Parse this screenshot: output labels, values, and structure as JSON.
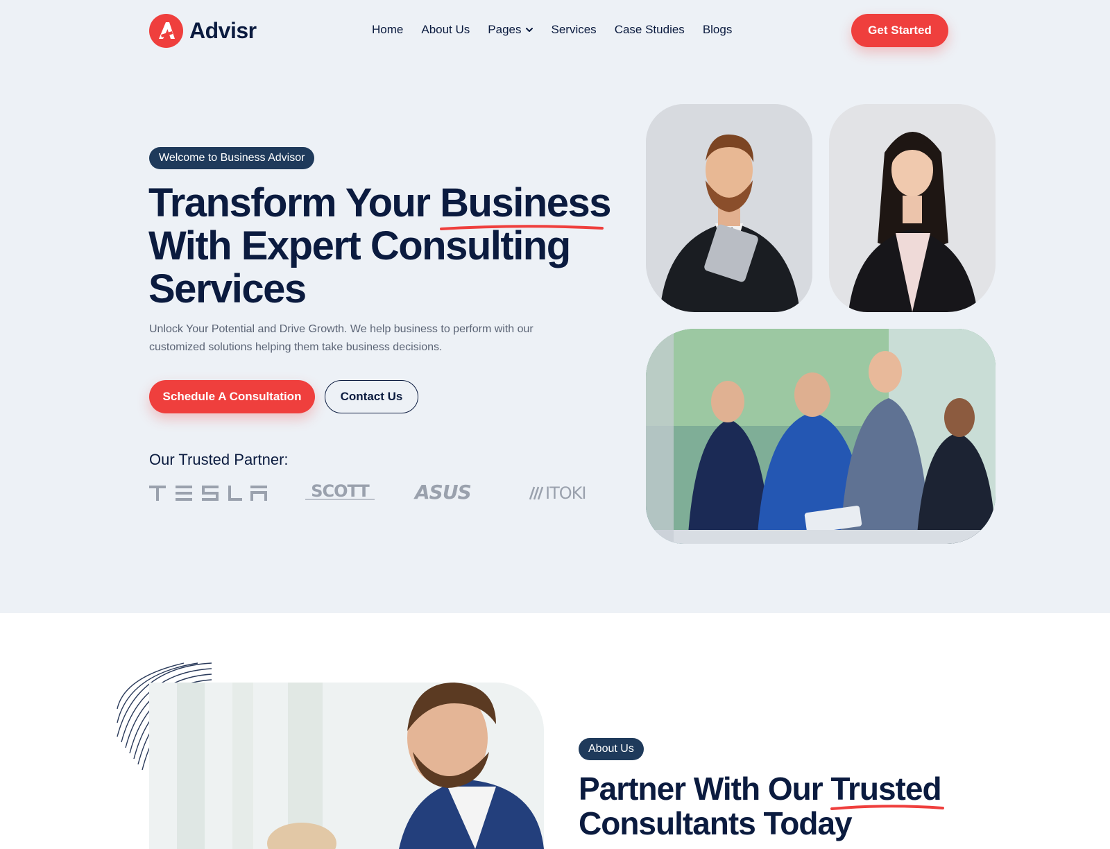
{
  "brand": {
    "name": "Advisr",
    "accent": "#ef3f3d",
    "navy": "#0b1b3f",
    "pill_bg": "#1f3a5b"
  },
  "nav": {
    "items": [
      {
        "label": "Home"
      },
      {
        "label": "About Us"
      },
      {
        "label": "Pages",
        "icon": "chevron-down-icon"
      },
      {
        "label": "Services"
      },
      {
        "label": "Case Studies"
      },
      {
        "label": "Blogs"
      }
    ],
    "cta_label": "Get Started"
  },
  "hero": {
    "eyebrow": "Welcome to Business Advisor",
    "title_part1": "Transform Your ",
    "title_highlight": "Business",
    "title_part2": "With Expert Consulting Services",
    "description": "Unlock Your Potential and Drive Growth. We help business to perform with our customized solutions helping them take business decisions.",
    "primary_button": "Schedule A Consultation",
    "secondary_button": "Contact Us",
    "partners_title": "Our Trusted Partner:",
    "partners": [
      "TESLA",
      "SCOTT",
      "ASUS",
      "ITOKI"
    ]
  },
  "about": {
    "eyebrow": "About Us",
    "title_part1": "Partner With Our ",
    "title_highlight": "Trusted",
    "title_part2": "Consultants Today"
  }
}
